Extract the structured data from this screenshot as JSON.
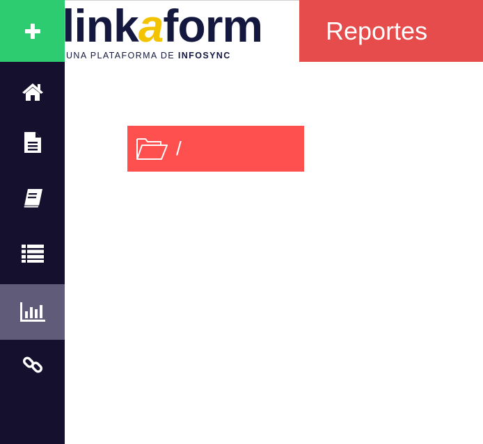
{
  "app": {
    "logo_main_pre": "link",
    "logo_main_a": "a",
    "logo_main_post": "form",
    "logo_tagline_pre": "UNA PLATAFORMA DE ",
    "logo_tagline_brand": "INFOSYNC"
  },
  "header": {
    "title": "Reportes"
  },
  "sidebar": {
    "add_icon": "plus-icon",
    "items": [
      {
        "id": "home",
        "icon": "home-icon",
        "active": false
      },
      {
        "id": "forms",
        "icon": "document-icon",
        "active": false
      },
      {
        "id": "catalogs",
        "icon": "book-icon",
        "active": false
      },
      {
        "id": "records",
        "icon": "list-icon",
        "active": false
      },
      {
        "id": "reports",
        "icon": "bar-chart-icon",
        "active": true
      },
      {
        "id": "links",
        "icon": "link-icon",
        "active": false
      }
    ]
  },
  "breadcrumb": {
    "icon": "folder-open-icon",
    "path": "/"
  },
  "colors": {
    "sidebar_bg": "#14102e",
    "sidebar_active": "#5f5b79",
    "add_button": "#2ecc71",
    "header_title_bg": "#e74c4c",
    "breadcrumb_bg": "#ff5050",
    "logo_navy": "#14183e",
    "logo_yellow": "#f3c300"
  }
}
